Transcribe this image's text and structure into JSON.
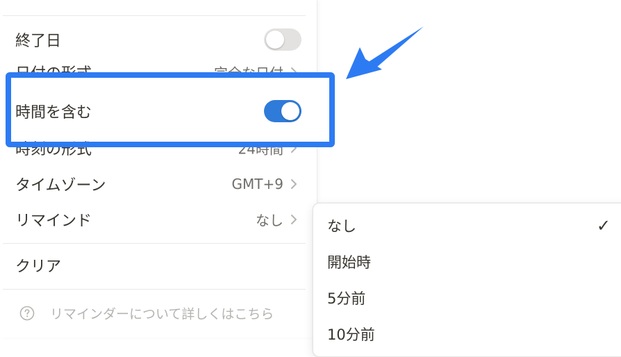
{
  "settings": {
    "end_date_label": "終了日",
    "date_format_label": "日付の形式",
    "date_format_value": "完全な日付",
    "include_time_label": "時間を含む",
    "time_format_label": "時刻の形式",
    "time_format_value": "24時間",
    "timezone_label": "タイムゾーン",
    "timezone_value": "GMT+9",
    "reminder_label": "リマインド",
    "reminder_value": "なし",
    "clear_label": "クリア",
    "help_text": "リマインダーについて詳しくはこちら",
    "help_icon": "question-circle-icon",
    "chevron_icon": "chevron-right-icon",
    "end_date_on": false,
    "include_time_on": true
  },
  "dropdown": {
    "options": [
      "なし",
      "開始時",
      "5分前",
      "10分前"
    ],
    "selected_index": 0,
    "check_icon": "✓"
  },
  "colors": {
    "highlight": "#2d7bf3",
    "toggle_on": "#2f7bd9",
    "toggle_off": "#e3e2e0"
  }
}
